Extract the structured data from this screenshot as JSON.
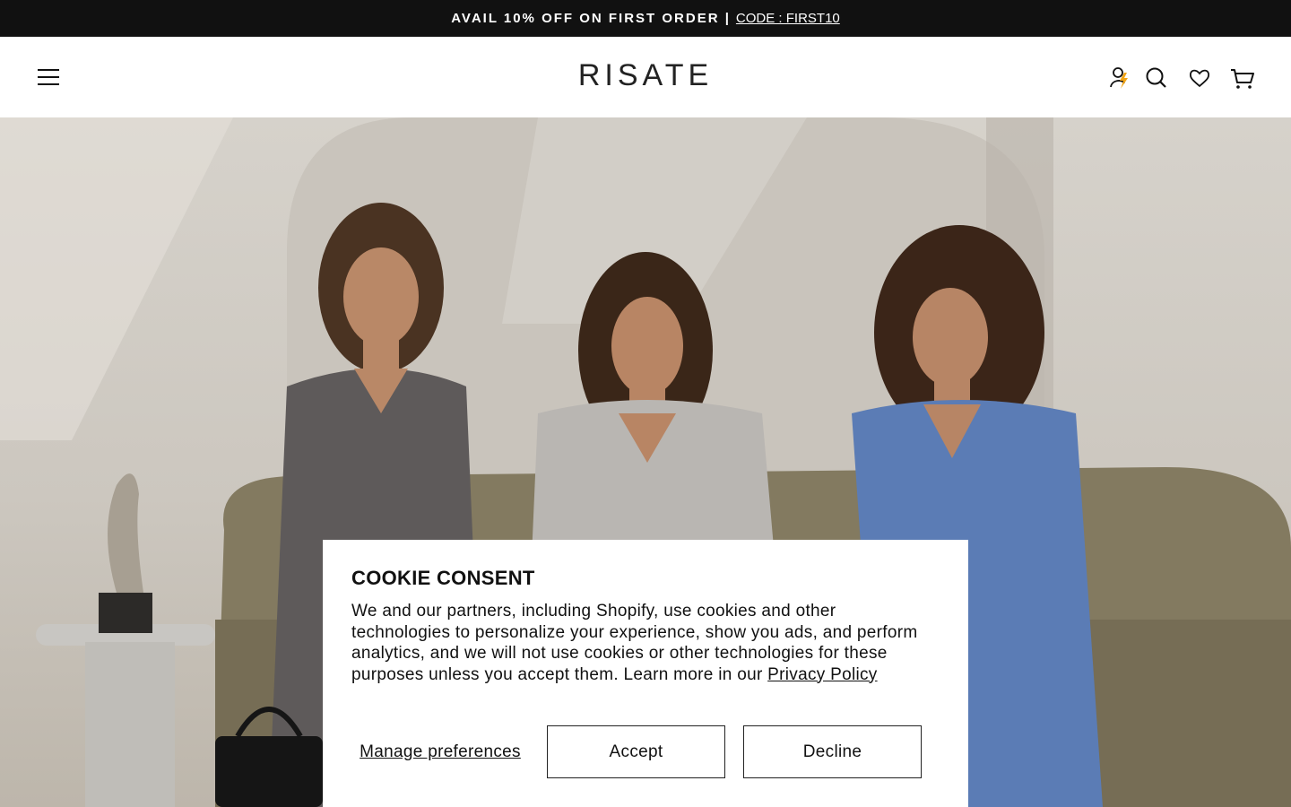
{
  "announcement": {
    "text": "AVAIL 10% OFF ON FIRST ORDER |",
    "code_link": "CODE : FIRST10"
  },
  "header": {
    "logo": "RISATE",
    "icons": [
      "menu-icon",
      "account-icon",
      "search-icon",
      "heart-icon",
      "cart-icon"
    ]
  },
  "cookie": {
    "title": "COOKIE CONSENT",
    "body": "We and our partners, including Shopify, use cookies and other technologies to personalize your experience, show you ads, and perform analytics, and we will not use cookies or other technologies for these purposes unless you accept them. Learn more in our ",
    "privacy_link": "Privacy Policy",
    "manage_label": "Manage preferences",
    "accept_label": "Accept",
    "decline_label": "Decline"
  },
  "colors": {
    "announcement_bg": "#111111",
    "account_accent": "#f2a516"
  }
}
